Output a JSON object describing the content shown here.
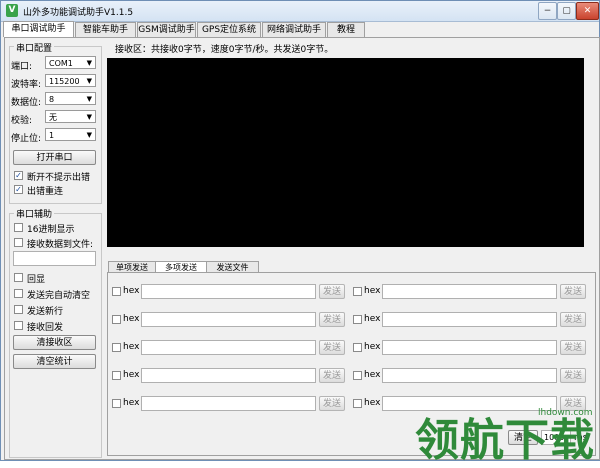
{
  "window": {
    "title": "山外多功能调试助手V1.1.5",
    "app_icon": "V",
    "controls": {
      "minimize": "−",
      "restore": "▢",
      "close": "✕"
    }
  },
  "tabs": [
    "串口调试助手",
    "智能车助手",
    "GSM调试助手",
    "GPS定位系统",
    "网络调试助手",
    "教程"
  ],
  "serial_config": {
    "title": "串口配置",
    "port_label": "端口:",
    "port_value": "COM1",
    "baud_label": "波特率:",
    "baud_value": "115200",
    "databits_label": "数据位:",
    "databits_value": "8",
    "parity_label": "校验:",
    "parity_value": "无",
    "stopbits_label": "停止位:",
    "stopbits_value": "1",
    "open_button": "打开串口",
    "no_error_prompt": "断开不提示出错",
    "reconnect": "出错重连"
  },
  "serial_aux": {
    "title": "串口辅助",
    "hex_display": "16进制显示",
    "save_to_file": "接收数据到文件:",
    "echo": "回显",
    "auto_clear": "发送完自动清空",
    "send_newline": "发送新行",
    "receive_echo": "接收回发",
    "clear_recv_button": "清接收区",
    "clear_stats_button": "清空统计"
  },
  "receive": {
    "status": "接收区：共接收0字节，速度0字节/秒。共发送0字节。"
  },
  "send_tabs": [
    "单项发送",
    "多项发送",
    "发送文件"
  ],
  "multi_send": {
    "hex_label": "hex",
    "send_label": "发送",
    "bottom_button": "清空",
    "bottom_value": "1000",
    "bottom_unit": "ms"
  },
  "watermark": {
    "text": "领航下载",
    "url": "lhdown.com"
  }
}
